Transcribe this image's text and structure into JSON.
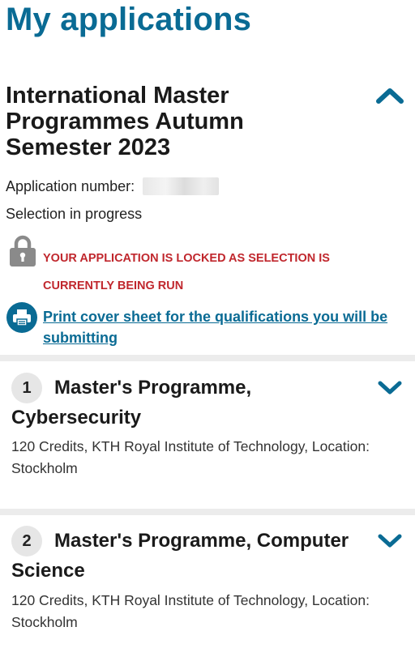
{
  "page": {
    "title": "My applications"
  },
  "application": {
    "term_title": "International Master Programmes Autumn Semester 2023",
    "number_label": "Application number:",
    "status": "Selection in progress",
    "lock_message": "YOUR APPLICATION IS LOCKED AS SELECTION IS CURRENTLY BEING RUN",
    "print_link": "Print cover sheet for the qualifications you will be submitting",
    "colors": {
      "brand_blue": "#0a6b94",
      "lock_red": "#c0272d"
    }
  },
  "programmes": [
    {
      "rank": "1",
      "title": "Master's Programme, Cybersecurity",
      "details": "120 Credits, KTH Royal Institute of Technology, Location: Stockholm"
    },
    {
      "rank": "2",
      "title": "Master's Programme, Computer Science",
      "details": "120 Credits, KTH Royal Institute of Technology, Location: Stockholm"
    }
  ],
  "icons": {
    "collapse": "chevron-up-icon",
    "expand": "chevron-down-icon",
    "lock": "padlock-icon",
    "print": "printer-icon"
  }
}
